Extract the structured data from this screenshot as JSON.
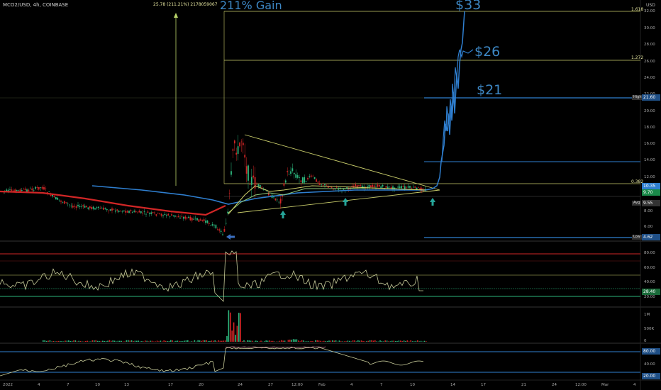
{
  "header": {
    "symbol": "MCO2/USD, 4h, COINBASE",
    "measure": "25.78 (211.21%) 2178059067",
    "currency": "USD"
  },
  "annotations": {
    "gain": "211% Gain",
    "target_33": "$33",
    "target_26": "$26",
    "target_21": "$21"
  },
  "fib_labels": {
    "f1618": "1.618",
    "f1272": "1.272",
    "f0382": "0.382"
  },
  "price_axis": {
    "ticks": [
      "32.00",
      "30.00",
      "28.00",
      "26.00",
      "24.00",
      "22.00",
      "20.00",
      "18.00",
      "16.00",
      "14.00",
      "12.00",
      "8.00",
      "6.00"
    ],
    "high_label": "High",
    "high_value": "21.60",
    "avg_label": "Avg",
    "avg_value": "9.55",
    "low_label": "Low",
    "low_value": "4.62",
    "current_value": "10.35",
    "current_value2": "9.70"
  },
  "rsi_axis": {
    "ticks": [
      "80.00",
      "60.00",
      "40.00"
    ],
    "current_value": "28.40",
    "low_value": "20.00"
  },
  "volume_axis": {
    "ticks": [
      "1M",
      "500K",
      "0"
    ]
  },
  "stoch_axis": {
    "upper_value": "80.00",
    "mid_value": "40.00",
    "lower_value": "20.00"
  },
  "time_axis": {
    "labels": [
      "2022",
      "4",
      "7",
      "10",
      "13",
      "17",
      "20",
      "24",
      "27",
      "12:00",
      "Feb",
      "4",
      "7",
      "10",
      "14",
      "17",
      "21",
      "24",
      "12:00",
      "Mar",
      "4"
    ]
  },
  "colors": {
    "background": "#000000",
    "blue": "#2f7fd0",
    "red": "#d12626",
    "green": "#2cb67d",
    "yellow": "#c8cc6a",
    "arrow_green": "#26a69a",
    "arrow_blue": "#3b6fc1"
  }
}
